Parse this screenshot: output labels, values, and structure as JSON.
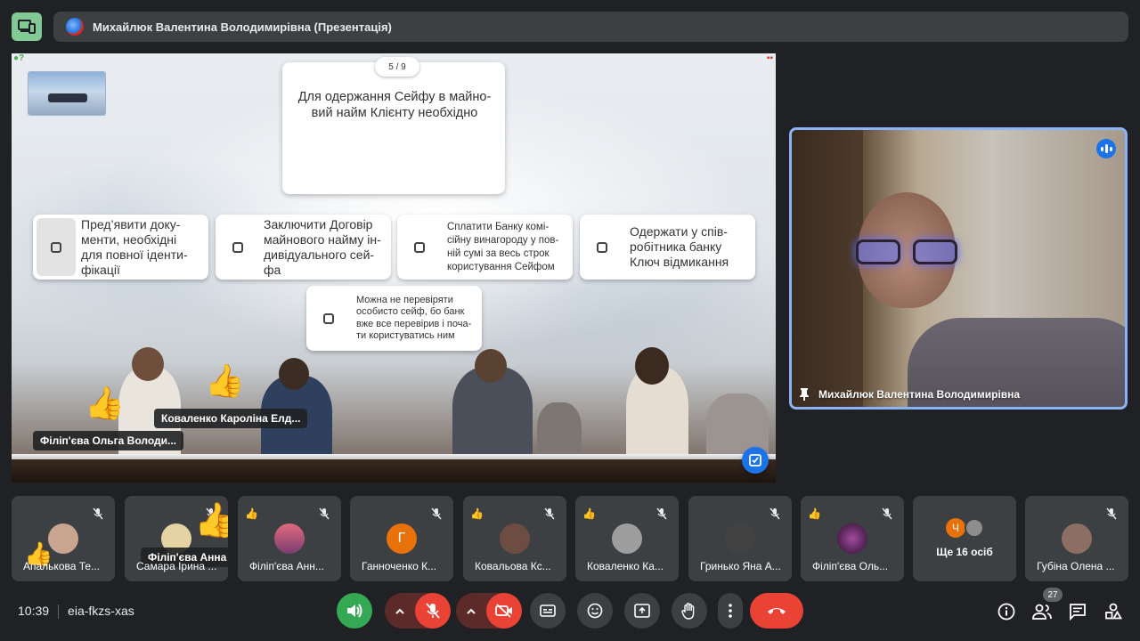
{
  "header": {
    "title": "Михайлюк Валентина Володимирівна (Презентація)"
  },
  "slide": {
    "counter": "5 / 9",
    "question": "Для одержання Сейфу в майно-вий найм Клієнту необхідно",
    "options": [
      "Пред’явити доку-менти, необхідні для повної іденти-фікації",
      "Заключити Договір майнового найму ін-дивідуального сей-фа",
      "Сплатити Банку комі-сійну винагороду у пов-ній сумі за весь строк користування Сейфом",
      "Одержати у спів-робітника банку Ключ відмикання",
      "Можна не перевіряти особисто сейф, бо банк вже все перевірив і поча-ти користуватись ним"
    ],
    "reactions": [
      {
        "name": "Коваленко Кароліна Елд..."
      },
      {
        "name": "Філіп'єва Ольга Володи..."
      }
    ]
  },
  "speaker": {
    "name": "Михайлюк Валентина Володимирівна"
  },
  "participants": [
    {
      "name": "Апалькова Те...",
      "initial": "",
      "avatar_color": "#c9a48e",
      "hand": true,
      "overlay_name": ""
    },
    {
      "name": "Самара Ірина ...",
      "initial": "",
      "avatar_color": "#e6d3a3",
      "hand": false,
      "overlay_name": "Філіп'єва Анна Володим..."
    },
    {
      "name": "Філіп'єва Анн...",
      "initial": "",
      "avatar_color": "#b5566d",
      "hand": true,
      "overlay_name": ""
    },
    {
      "name": "Ганноченко К...",
      "initial": "Г",
      "avatar_color": "#e8710a",
      "hand": false,
      "overlay_name": ""
    },
    {
      "name": "Ковальова Кс...",
      "initial": "",
      "avatar_color": "#6d4c41",
      "hand": true,
      "overlay_name": ""
    },
    {
      "name": "Коваленко Ка...",
      "initial": "",
      "avatar_color": "#9e9e9e",
      "hand": true,
      "overlay_name": ""
    },
    {
      "name": "Гринько Яна А...",
      "initial": "",
      "avatar_color": "#424242",
      "hand": false,
      "overlay_name": ""
    },
    {
      "name": "Філіп'єва Оль...",
      "initial": "",
      "avatar_color": "#4a1c4f",
      "hand": true,
      "overlay_name": ""
    },
    {
      "name": "Ще 16 осіб",
      "initial": "Ч",
      "avatar_color": "#e8710a",
      "hand": false,
      "overlay_name": ""
    },
    {
      "name": "Губіна Олена ...",
      "initial": "",
      "avatar_color": "#8d6e63",
      "hand": false,
      "overlay_name": ""
    }
  ],
  "bottom_bar": {
    "time": "10:39",
    "meeting_code": "eia-fkzs-xas",
    "people_count": "27"
  },
  "colors": {
    "accent_blue": "#8ab4f8",
    "end_call_red": "#ea4335",
    "sound_green": "#34a853"
  }
}
